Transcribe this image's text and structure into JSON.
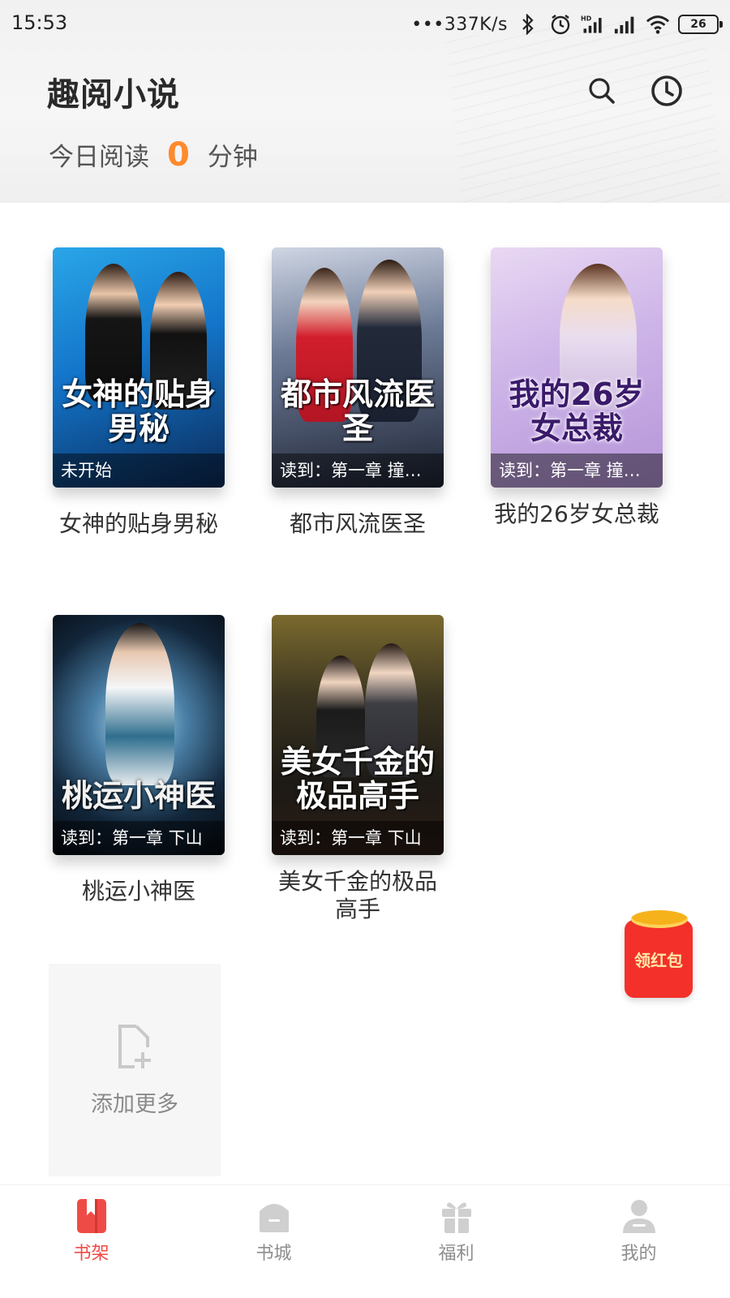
{
  "status_bar": {
    "time": "15:53",
    "network_speed": "•••337K/s",
    "battery": "26",
    "icons": [
      "bluetooth-icon",
      "alarm-icon",
      "hd-signal-icon",
      "signal-icon",
      "wifi-icon",
      "battery-icon"
    ]
  },
  "header": {
    "app_title": "趣阅小说",
    "reading_prefix": "今日阅读",
    "reading_minutes": "0",
    "reading_suffix": "分钟",
    "accent_color": "#ff8a2b"
  },
  "books": [
    {
      "name": "女神的贴身男秘",
      "cover_title": "女神的贴身男秘",
      "progress": "未开始"
    },
    {
      "name": "都市风流医圣",
      "cover_title": "都市风流医圣",
      "progress": "读到：第一章 撞…"
    },
    {
      "name": "我的26岁女总裁",
      "cover_title": "我的26岁女总裁",
      "progress": "读到：第一章 撞…"
    },
    {
      "name": "桃运小神医",
      "cover_title": "桃运小神医",
      "progress": "读到：第一章 下山"
    },
    {
      "name": "美女千金的极品高手",
      "cover_title": "美女千金的极品高手",
      "progress": "读到：第一章 下山"
    }
  ],
  "add_more": {
    "label": "添加更多"
  },
  "red_packet": {
    "label": "领红包"
  },
  "bottom_nav": [
    {
      "label": "书架",
      "icon": "bookshelf-icon",
      "active": true
    },
    {
      "label": "书城",
      "icon": "bookstore-icon",
      "active": false
    },
    {
      "label": "福利",
      "icon": "gift-icon",
      "active": false
    },
    {
      "label": "我的",
      "icon": "profile-icon",
      "active": false
    }
  ],
  "colors": {
    "nav_active": "#ef4b46",
    "nav_inactive": "#8d8d8d",
    "red_packet": "#f3302a"
  }
}
